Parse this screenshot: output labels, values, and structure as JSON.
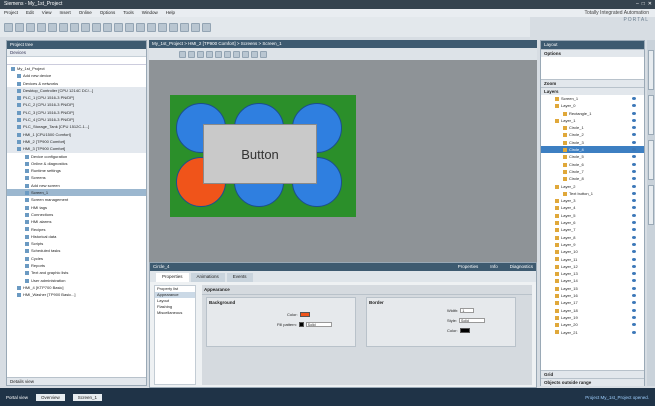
{
  "window": {
    "title": "Siemens - My_1st_Project"
  },
  "menu": [
    "Project",
    "Edit",
    "View",
    "Insert",
    "Online",
    "Options",
    "Tools",
    "Window",
    "Help"
  ],
  "brand": {
    "line1": "Totally Integrated Automation",
    "line2": "PORTAL"
  },
  "project_tree": {
    "header": "Project tree",
    "tab": "Devices",
    "items": [
      "My_1st_Project",
      "Add new device",
      "Devices & networks",
      "Desktop_Controller [CPU 1214C DC/...]",
      "PLC_1 [CPU 1516-3 PN/DP]",
      "PLC_2 [CPU 1516-3 PN/DP]",
      "PLC_3 [CPU 1516-3 PN/DP]",
      "PLC_4 [CPU 1516-3 PN/DP]",
      "PLC_Storage_Tank [CPU 1512C-1...]",
      "HMI_1 [CPU1500 Comfort]",
      "HMI_2 [TP900 Comfort]",
      "HMI_3 [TP900 Comfort]",
      "Device configuration",
      "Online & diagnostics",
      "Runtime settings",
      "Screens",
      "Add new screen",
      "Screen_1",
      "Screen management",
      "HMI tags",
      "Connections",
      "HMI alarms",
      "Recipes",
      "Historical data",
      "Scripts",
      "Scheduled tasks",
      "Cycles",
      "Reports",
      "Text and graphic lists",
      "User administration",
      "HMI_4 [KTP700 Basic]",
      "HMI_Washer [TP900 Basic...]"
    ],
    "selected_index": 17,
    "details_view": "Details view"
  },
  "editor": {
    "breadcrumb": "My_1st_Project > HMI_2 [TP900 Comfort] > Screens > Screen_1",
    "button_label": "Button"
  },
  "inspector": {
    "title": "Circle_4",
    "tabs_right": [
      "Properties",
      "Info",
      "Diagnostics"
    ],
    "tabs": [
      "Properties",
      "Animations",
      "Events"
    ],
    "nav": [
      "Property list",
      "Appearance",
      "Layout",
      "Flashing",
      "Miscellaneous"
    ],
    "nav_selected": 1,
    "group_title": "Appearance",
    "background": {
      "title": "Background",
      "color_label": "Color:",
      "fill_label": "Fill pattern:",
      "fill_value": "Solid",
      "color": "#f0541a"
    },
    "border": {
      "title": "Border",
      "width_label": "Width:",
      "width_value": "1",
      "style_label": "Style:",
      "style_value": "Solid",
      "color_label": "Color:"
    }
  },
  "layers": {
    "header": "Layout",
    "options": "Options",
    "sections": [
      "Zoom",
      "Layers"
    ],
    "items": [
      "Screen_1",
      "Layer_0",
      "Rectangle_1",
      "Layer_1",
      "Circle_1",
      "Circle_2",
      "Circle_3",
      "Circle_4",
      "Circle_5",
      "Circle_6",
      "Circle_7",
      "Circle_8",
      "Layer_2",
      "Text button_1",
      "Layer_3",
      "Layer_4",
      "Layer_5",
      "Layer_6",
      "Layer_7",
      "Layer_8",
      "Layer_9",
      "Layer_10",
      "Layer_11",
      "Layer_12",
      "Layer_13",
      "Layer_14",
      "Layer_15",
      "Layer_16",
      "Layer_17",
      "Layer_18",
      "Layer_19",
      "Layer_20",
      "Layer_21"
    ],
    "selected_index": 7,
    "bottom": [
      "Grid",
      "Objects outside range"
    ]
  },
  "status": {
    "portal": "Portal view",
    "overview": "Overview",
    "screen_tab": "Screen_1",
    "message": "Project My_1st_Project opened."
  }
}
